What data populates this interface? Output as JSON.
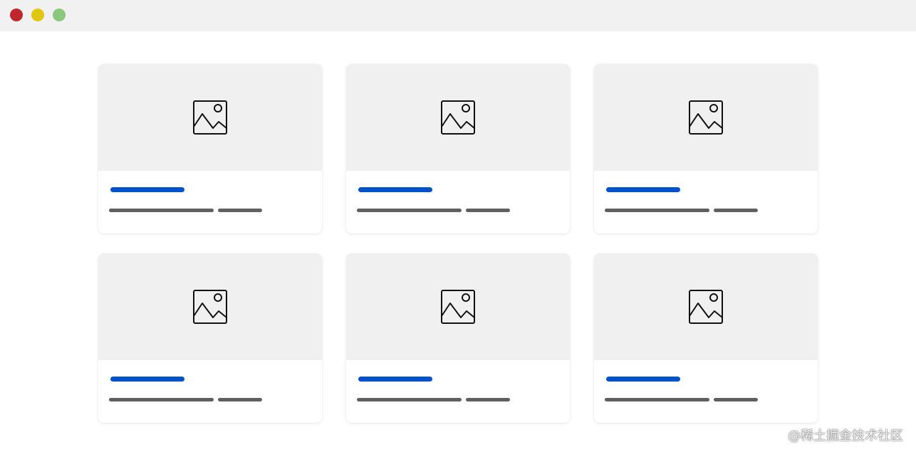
{
  "window": {
    "controls": [
      {
        "name": "close",
        "color": "#c0272d"
      },
      {
        "name": "minimize",
        "color": "#e2c50f"
      },
      {
        "name": "maximize",
        "color": "#8cc87c"
      }
    ]
  },
  "cards": [
    {
      "thumbnail_icon": "image-icon"
    },
    {
      "thumbnail_icon": "image-icon"
    },
    {
      "thumbnail_icon": "image-icon"
    },
    {
      "thumbnail_icon": "image-icon"
    },
    {
      "thumbnail_icon": "image-icon"
    },
    {
      "thumbnail_icon": "image-icon"
    }
  ],
  "colors": {
    "title_bar": "#0052cc",
    "text_bar": "#5f5f5f",
    "thumbnail_bg": "#f0f0f0",
    "titlebar_bg": "#f1f1f1"
  },
  "watermark": "@稀土掘金技术社区"
}
